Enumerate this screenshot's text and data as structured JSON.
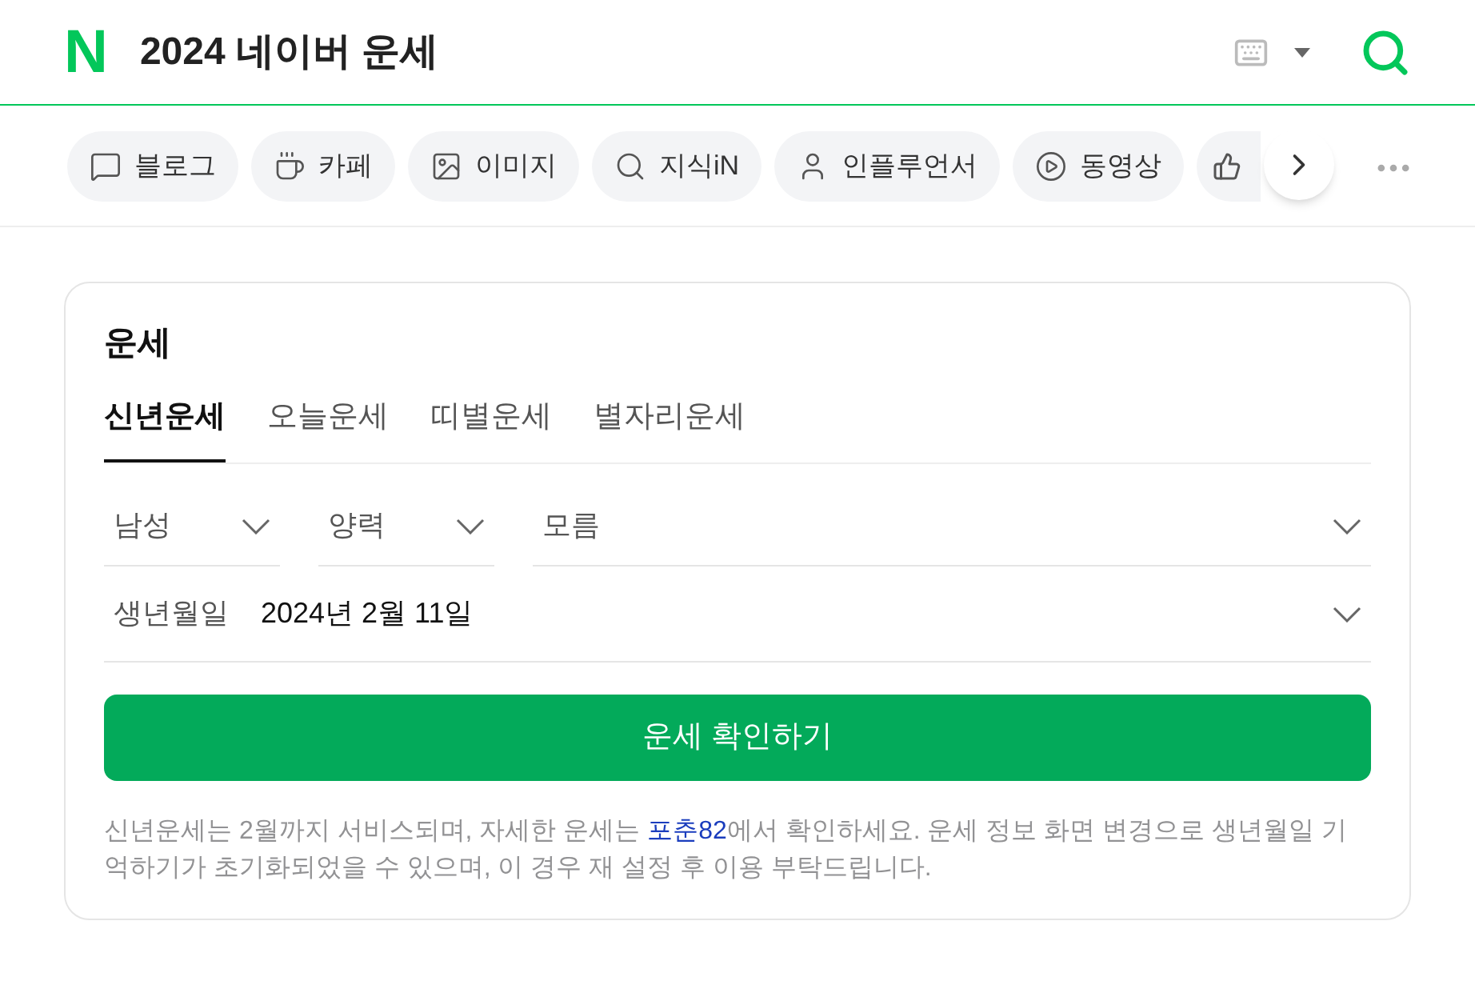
{
  "header": {
    "logo": "N",
    "title": "2024 네이버 운세"
  },
  "chips": [
    {
      "label": "블로그"
    },
    {
      "label": "카페"
    },
    {
      "label": "이미지"
    },
    {
      "label": "지식iN"
    },
    {
      "label": "인플루언서"
    },
    {
      "label": "동영상"
    }
  ],
  "card": {
    "title": "운세",
    "tabs": [
      {
        "label": "신년운세",
        "selected": true
      },
      {
        "label": "오늘운세",
        "selected": false
      },
      {
        "label": "띠별운세",
        "selected": false
      },
      {
        "label": "별자리운세",
        "selected": false
      }
    ],
    "selects": [
      "남성",
      "양력",
      "모름"
    ],
    "birth": {
      "label": "생년월일",
      "value": "2024년 2월 11일"
    },
    "button": "운세 확인하기",
    "note": {
      "before": "신년운세는 2월까지 서비스되며, 자세한 운세는 ",
      "link": "포춘82",
      "after": "에서 확인하세요. 운세 정보 화면 변경으로 생년월일 기억하기가 초기화되었을 수 있으며, 이 경우 재 설정 후 이용 부탁드립니다."
    }
  }
}
